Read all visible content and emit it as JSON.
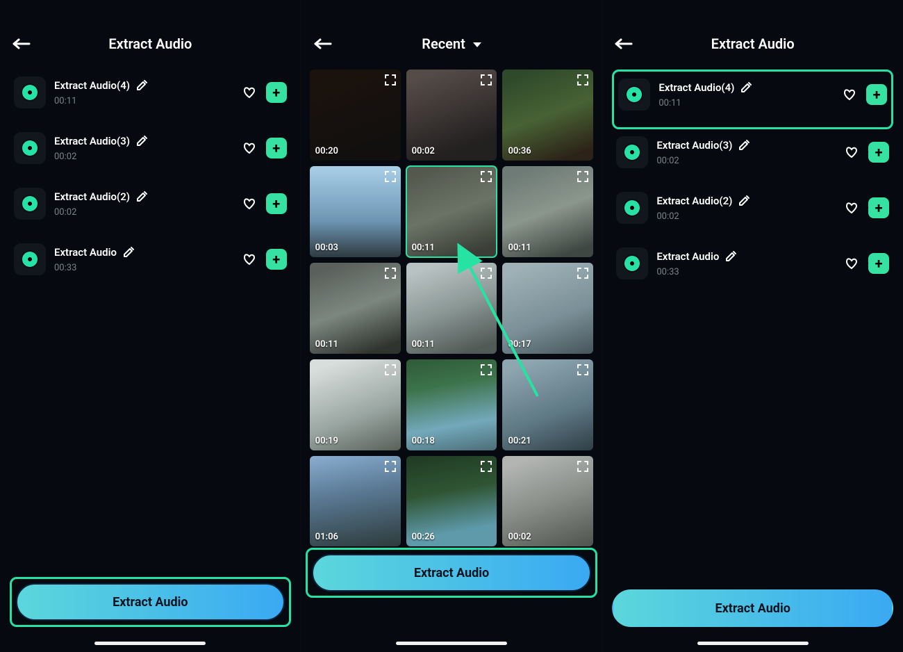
{
  "screens": {
    "left": {
      "title": "Extract Audio",
      "items": [
        {
          "name": "Extract Audio(4)",
          "time": "00:11"
        },
        {
          "name": "Extract Audio(3)",
          "time": "00:02"
        },
        {
          "name": "Extract Audio(2)",
          "time": "00:02"
        },
        {
          "name": "Extract Audio",
          "time": "00:33"
        }
      ],
      "cta": "Extract Audio"
    },
    "middle": {
      "title": "Recent",
      "clips": [
        {
          "dur": "00:20"
        },
        {
          "dur": "00:02"
        },
        {
          "dur": "00:36"
        },
        {
          "dur": "00:03"
        },
        {
          "dur": "00:11"
        },
        {
          "dur": "00:11"
        },
        {
          "dur": "00:11"
        },
        {
          "dur": "00:11"
        },
        {
          "dur": "00:17"
        },
        {
          "dur": "00:19"
        },
        {
          "dur": "00:18"
        },
        {
          "dur": "00:21"
        },
        {
          "dur": "01:06"
        },
        {
          "dur": "00:26"
        },
        {
          "dur": "00:02"
        }
      ],
      "selected_index": 4,
      "cta": "Extract Audio"
    },
    "right": {
      "title": "Extract Audio",
      "items": [
        {
          "name": "Extract Audio(4)",
          "time": "00:11"
        },
        {
          "name": "Extract Audio(3)",
          "time": "00:02"
        },
        {
          "name": "Extract Audio(2)",
          "time": "00:02"
        },
        {
          "name": "Extract Audio",
          "time": "00:33"
        }
      ],
      "highlight_index": 0,
      "cta": "Extract Audio"
    }
  }
}
